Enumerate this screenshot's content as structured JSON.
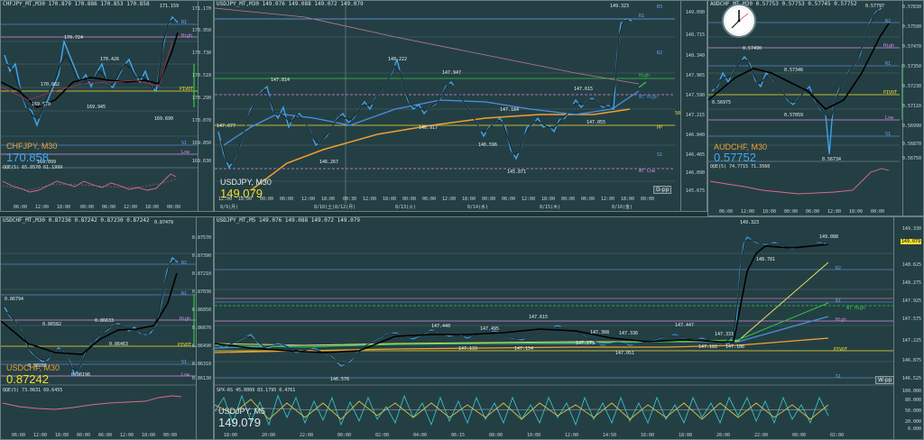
{
  "colors": {
    "bg": "#243f44",
    "grid": "#4e6a70",
    "bull": "#3fa9f5",
    "bear": "#1e2a2e",
    "accent_orange": "#f0a030",
    "accent_yellow": "#f5e02a",
    "pivot_pink": "#d88be0",
    "wt_blue": "#4a90e2",
    "green": "#2ecc40"
  },
  "icons": {
    "clock": "analog-clock-icon"
  },
  "chf": {
    "header": "CHFJPY_MT,M30  170.879 170.886 170.853 170.858",
    "symbol": "CHFJPY, M30",
    "price": "170.858",
    "osc_header": "QQE(5) 65.0570 61.1999",
    "axis": [
      "171.170",
      "170.950",
      "170.730",
      "170.510",
      "170.290",
      "170.070",
      "169.850",
      "169.630"
    ],
    "tags": [
      {
        "t": "R1",
        "c": "#6aa8ff"
      },
      {
        "t": "High",
        "c": "#d88be0"
      },
      {
        "t": "PIVOT",
        "c": "#f5e02a"
      },
      {
        "t": "S1",
        "c": "#6aa8ff"
      },
      {
        "t": "Low",
        "c": "#d88be0"
      }
    ],
    "points": [
      {
        "t": "171.159"
      },
      {
        "t": "170.724"
      },
      {
        "t": "170.426"
      },
      {
        "t": "170.082"
      },
      {
        "t": "169.945"
      },
      {
        "t": "169.690"
      },
      {
        "t": "169.570"
      },
      {
        "t": "169.099"
      }
    ],
    "times": [
      "06:00",
      "12:00",
      "18:00",
      "00:00",
      "06:00",
      "12:00",
      "18:00",
      "00:00"
    ]
  },
  "uj30": {
    "header": "USDJPY_MT,M30  149.076 149.088 149.072 149.079",
    "symbol": "USDJPY, M30",
    "price": "149.079",
    "button": "D-pp",
    "axis": [
      "149.090",
      "148.715",
      "148.340",
      "147.965",
      "147.590",
      "147.215",
      "146.840",
      "146.465",
      "146.090",
      "145.675"
    ],
    "right_tags": [
      {
        "t": "R1",
        "c": "#6aa8ff"
      },
      {
        "t": "R2",
        "c": "#6aa8ff"
      },
      {
        "t": "High",
        "c": "#2ecc40"
      },
      {
        "t": "WT High",
        "c": "#4a90e2"
      },
      {
        "t": "50",
        "c": "#f5e02a"
      },
      {
        "t": "PP",
        "c": "#f5e02a"
      },
      {
        "t": "S1",
        "c": "#6aa8ff"
      },
      {
        "t": "WT Low",
        "c": "#d88be0"
      },
      {
        "t": "R3",
        "c": "#6aa8ff"
      }
    ],
    "points": [
      {
        "t": "149.323"
      },
      {
        "t": "148.222"
      },
      {
        "t": "147.947"
      },
      {
        "t": "147.814"
      },
      {
        "t": "147.615"
      },
      {
        "t": "147.184"
      },
      {
        "t": "146.917"
      },
      {
        "t": "147.055"
      },
      {
        "t": "146.596"
      },
      {
        "t": "146.267"
      },
      {
        "t": "145.871"
      },
      {
        "t": "147.077"
      }
    ],
    "times": [
      "12:00",
      "18:00",
      "00:00",
      "06:00",
      "12:00",
      "18:00",
      "00:30",
      "12:00",
      "18:00",
      "00:00",
      "06:00",
      "12:00",
      "18:00",
      "00:00",
      "06:00",
      "12:00",
      "18:00",
      "00:00",
      "06:00",
      "12:00",
      "18:00",
      "00:00"
    ],
    "dates": [
      "8/9(月)",
      "8/10(土)8/12(月)",
      "8/13(火)",
      "8/14(水)",
      "8/15(木)",
      "8/16(金)"
    ]
  },
  "aud": {
    "header": "AUDCHF_MT,M30  0.57753 0.57753 0.57745 0.57752",
    "symbol": "AUDCHF, M30",
    "price": "0.57752",
    "osc_header": "QQE(5) 74.7715 71.3560",
    "axis": [
      "0.57830",
      "0.57590",
      "0.57470",
      "0.57350",
      "0.57230",
      "0.57110",
      "0.56990",
      "0.56870",
      "0.56750"
    ],
    "tags": [
      {
        "t": "R2",
        "c": "#6aa8ff"
      },
      {
        "t": "High",
        "c": "#d88be0"
      },
      {
        "t": "R1",
        "c": "#6aa8ff"
      },
      {
        "t": "PIVOT",
        "c": "#f5e02a"
      },
      {
        "t": "Low",
        "c": "#d88be0"
      },
      {
        "t": "S1",
        "c": "#6aa8ff"
      }
    ],
    "points": [
      {
        "t": "0.57797"
      },
      {
        "t": "0.57490"
      },
      {
        "t": "0.57346"
      },
      {
        "t": "0.57059"
      },
      {
        "t": "0.56975"
      },
      {
        "t": "0.56734"
      }
    ],
    "times": [
      "06:00",
      "12:00",
      "18:00",
      "00:00",
      "06:00",
      "12:00",
      "18:00",
      "00:00"
    ]
  },
  "uchf": {
    "header": "USDCHF_MT,M30  0.87236 0.87242 0.87230 0.87242",
    "symbol": "USDCHF, M30",
    "price": "0.87242",
    "osc_header": "QQE(5) 73.0631 69.6455",
    "axis": [
      "0.87570",
      "0.87390",
      "0.87210",
      "0.87030",
      "0.86850",
      "0.86670",
      "0.86490",
      "0.86310",
      "0.86130"
    ],
    "tags": [
      {
        "t": "R2",
        "c": "#6aa8ff"
      },
      {
        "t": "R1",
        "c": "#6aa8ff"
      },
      {
        "t": "High",
        "c": "#d88be0"
      },
      {
        "t": "PIVOT",
        "c": "#f5e02a"
      },
      {
        "t": "S1",
        "c": "#6aa8ff"
      },
      {
        "t": "Low",
        "c": "#d88be0"
      }
    ],
    "points": [
      {
        "t": "0.87479"
      },
      {
        "t": "0.86794"
      },
      {
        "t": "0.86633"
      },
      {
        "t": "0.86582"
      },
      {
        "t": "0.86463"
      },
      {
        "t": "0.86286"
      },
      {
        "t": "0.86196"
      }
    ],
    "times": [
      "06:00",
      "12:00",
      "18:00",
      "00:00",
      "06:00",
      "12:00",
      "18:00",
      "00:00"
    ]
  },
  "uj5": {
    "header": "USDJPY_MT,M5  149.076 149.088 149.072 149.079",
    "symbol": "USDJPY, M5",
    "price": "149.079",
    "button": "W-pp",
    "osc_header": "SPX-RS 45.0009 83.1795 0.4761",
    "axis": [
      "149.330",
      "149.079",
      "148.625",
      "148.275",
      "147.925",
      "147.575",
      "147.225",
      "146.875",
      "146.525"
    ],
    "right_tags": [
      {
        "t": "R2",
        "c": "#6aa8ff"
      },
      {
        "t": "R1",
        "c": "#6aa8ff"
      },
      {
        "t": "WT High",
        "c": "#2ecc40"
      },
      {
        "t": "High",
        "c": "#d88be0"
      },
      {
        "t": "PIVOT",
        "c": "#f5e02a"
      },
      {
        "t": "S1",
        "c": "#6aa8ff"
      }
    ],
    "points": [
      {
        "t": "149.323"
      },
      {
        "t": "149.088"
      },
      {
        "t": "148.781"
      },
      {
        "t": "147.615"
      },
      {
        "t": "147.495"
      },
      {
        "t": "147.440"
      },
      {
        "t": "147.447"
      },
      {
        "t": "147.368"
      },
      {
        "t": "147.336"
      },
      {
        "t": "147.331"
      },
      {
        "t": "147.273"
      },
      {
        "t": "147.182"
      },
      {
        "t": "147.186"
      },
      {
        "t": "147.154"
      },
      {
        "t": "147.133"
      },
      {
        "t": "147.051"
      },
      {
        "t": "146.576"
      }
    ],
    "times": [
      "18:00",
      "20:00",
      "22:00",
      "00:00",
      "02:00",
      "04:00",
      "06:15",
      "08:00",
      "10:00",
      "12:00",
      "14:50",
      "16:00",
      "18:00",
      "20:00",
      "22:00",
      "00:00",
      "02:00"
    ],
    "osc_axis": [
      "100.000",
      "80.000",
      "50.000",
      "20.000",
      "0.000"
    ]
  }
}
